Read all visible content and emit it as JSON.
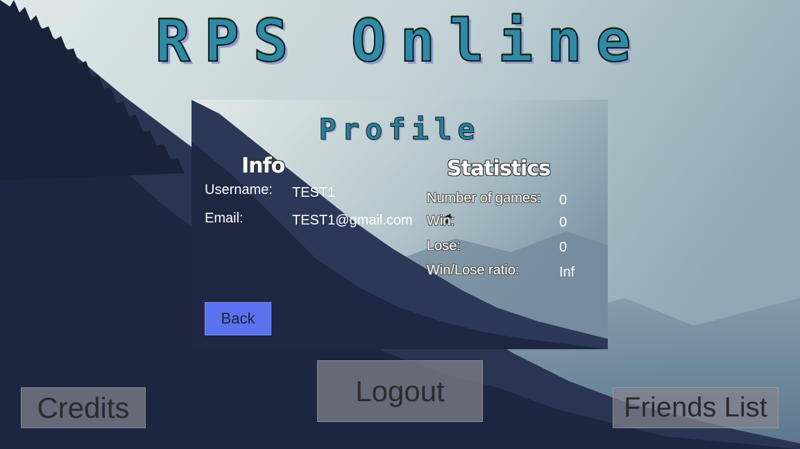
{
  "game_title": "RPS Online",
  "profile": {
    "title": "Profile",
    "info_heading": "Info",
    "username_label": "Username:",
    "username_value": "TEST1",
    "email_label": "Email:",
    "email_value": "TEST1@gmail.com",
    "stats_heading": "Statistics",
    "stats": [
      {
        "label": "Number of games:",
        "value": "0"
      },
      {
        "label": "Win:",
        "value": "0"
      },
      {
        "label": "Lose:",
        "value": "0"
      },
      {
        "label": "Win/Lose ratio:",
        "value": "Inf"
      }
    ],
    "back_label": "Back"
  },
  "buttons": {
    "logout": "Logout",
    "credits": "Credits",
    "friends": "Friends List"
  },
  "colors": {
    "back_button": "#5b72f0",
    "title_fill": "#2f8aa4",
    "sky": "#cdd8da",
    "mountain": "#1c2438"
  }
}
